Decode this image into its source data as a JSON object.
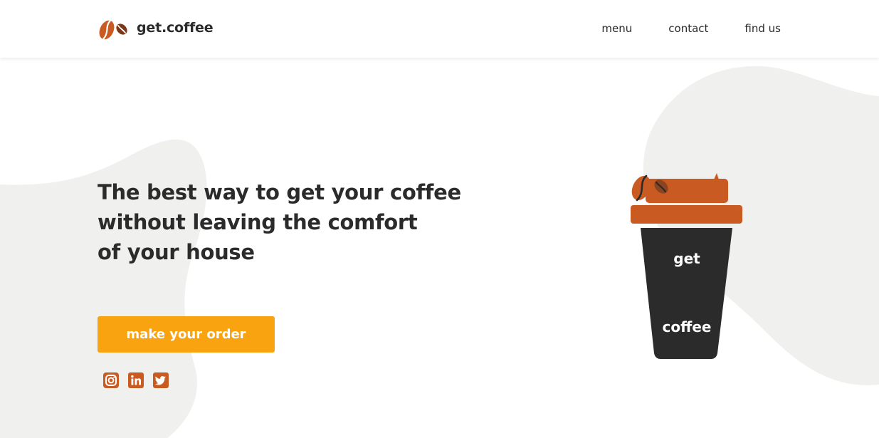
{
  "brand": {
    "name": "get.coffee",
    "logo_icon": "coffee-beans-icon"
  },
  "nav": {
    "items": [
      {
        "label": "menu"
      },
      {
        "label": "contact"
      },
      {
        "label": "find us"
      }
    ]
  },
  "hero": {
    "headline_lines": [
      "The best way to get your coffee",
      "without leaving the comfort",
      "of your house"
    ],
    "cta_label": "make your order"
  },
  "social": [
    {
      "icon": "instagram-icon"
    },
    {
      "icon": "linkedin-icon"
    },
    {
      "icon": "twitter-icon"
    }
  ],
  "cup": {
    "top_text": "get",
    "bottom_text": "coffee"
  },
  "colors": {
    "accent_orange": "#c95b22",
    "cta_yellow": "#f9a311",
    "dark": "#2b2b2b",
    "blob_gray": "#f0f0ef"
  }
}
